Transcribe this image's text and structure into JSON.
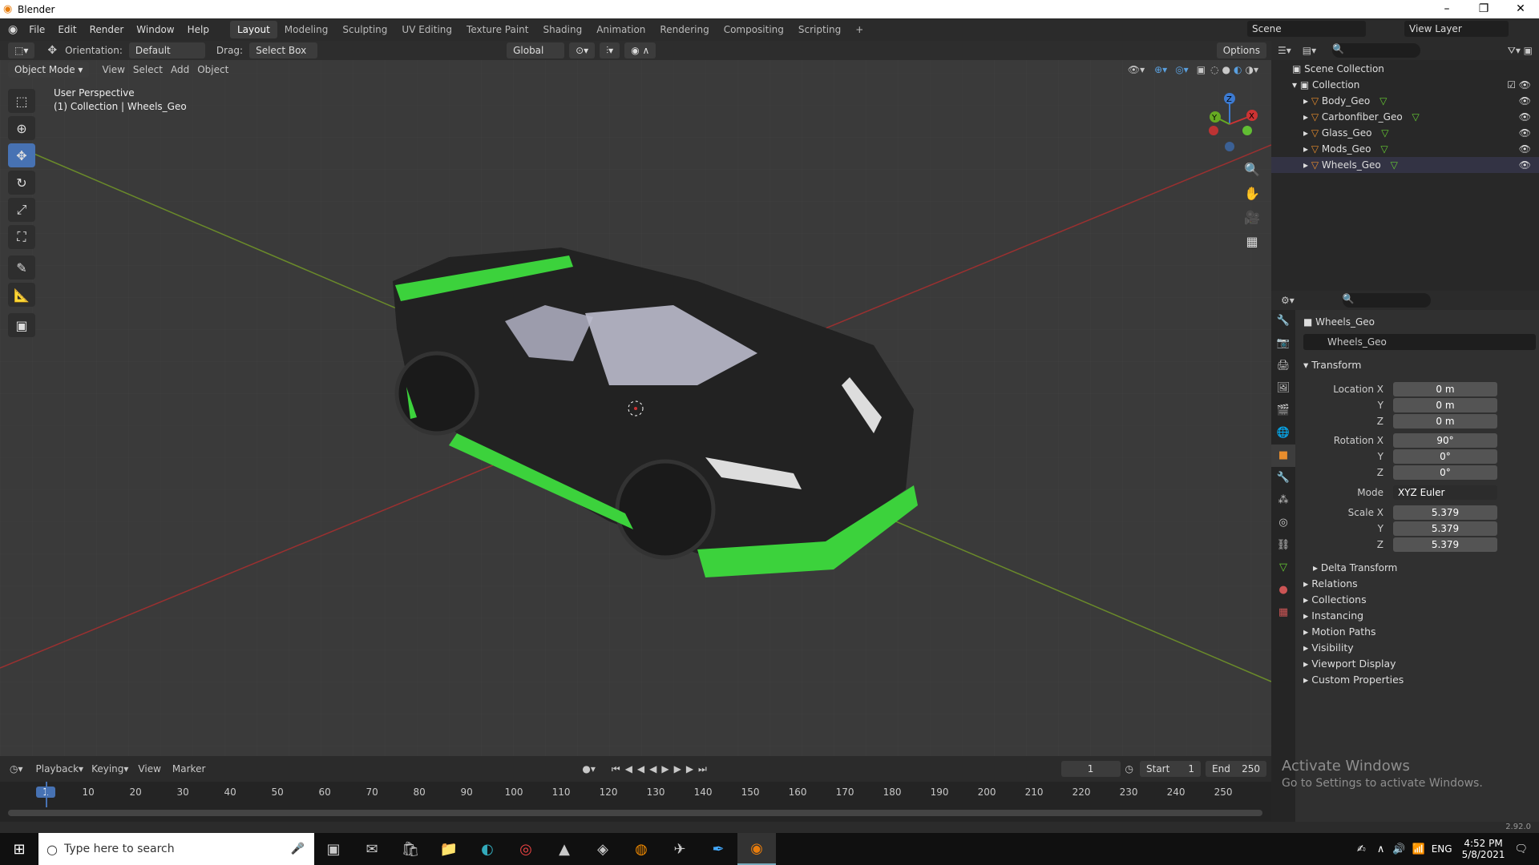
{
  "app": {
    "title": "Blender",
    "version": "2.92.0",
    "min": "–",
    "max": "❐",
    "close": "✕"
  },
  "menu": [
    "File",
    "Edit",
    "Render",
    "Window",
    "Help"
  ],
  "workspaces": [
    "Layout",
    "Modeling",
    "Sculpting",
    "UV Editing",
    "Texture Paint",
    "Shading",
    "Animation",
    "Rendering",
    "Compositing",
    "Scripting",
    "+"
  ],
  "scene": {
    "label": "Scene",
    "view_layer": "View Layer"
  },
  "viewport": {
    "orientation_label": "Orientation:",
    "orientation": "Default",
    "drag_label": "Drag:",
    "drag": "Select Box",
    "transform_space": "Global",
    "options": "Options",
    "mode": "Object Mode",
    "view": "View",
    "select": "Select",
    "add": "Add",
    "object": "Object",
    "overlay_title": "User Perspective",
    "overlay_subtitle": "(1) Collection | Wheels_Geo",
    "gizmo_x": "X",
    "gizmo_y": "Y",
    "gizmo_z": "Z"
  },
  "outliner": {
    "root": "Scene Collection",
    "collection": "Collection",
    "items": [
      "Body_Geo",
      "Carbonfiber_Geo",
      "Glass_Geo",
      "Mods_Geo",
      "Wheels_Geo"
    ]
  },
  "properties": {
    "object_name": "Wheels_Geo",
    "object_field": "Wheels_Geo",
    "transform": "Transform",
    "location_label": "Location X",
    "loc": [
      "0 m",
      "0 m",
      "0 m"
    ],
    "rotation_label": "Rotation X",
    "rot": [
      "90°",
      "0°",
      "0°"
    ],
    "mode_label": "Mode",
    "mode": "XYZ Euler",
    "scale_label": "Scale X",
    "scale": [
      "5.379",
      "5.379",
      "5.379"
    ],
    "axis_y": "Y",
    "axis_z": "Z",
    "delta": "Delta Transform",
    "sections": [
      "Relations",
      "Collections",
      "Instancing",
      "Motion Paths",
      "Visibility",
      "Viewport Display",
      "Custom Properties"
    ]
  },
  "timeline": {
    "playback": "Playback",
    "keying": "Keying",
    "view": "View",
    "marker": "Marker",
    "current": "1",
    "start_label": "Start",
    "start": "1",
    "end_label": "End",
    "end": "250",
    "ticks": [
      "1",
      "10",
      "20",
      "30",
      "40",
      "50",
      "60",
      "70",
      "80",
      "90",
      "100",
      "110",
      "120",
      "130",
      "140",
      "150",
      "160",
      "170",
      "180",
      "190",
      "200",
      "210",
      "220",
      "230",
      "240",
      "250"
    ]
  },
  "activate": {
    "title": "Activate Windows",
    "subtitle": "Go to Settings to activate Windows."
  },
  "taskbar": {
    "search_placeholder": "Type here to search",
    "lang": "ENG",
    "time": "4:52 PM",
    "date": "5/8/2021"
  }
}
